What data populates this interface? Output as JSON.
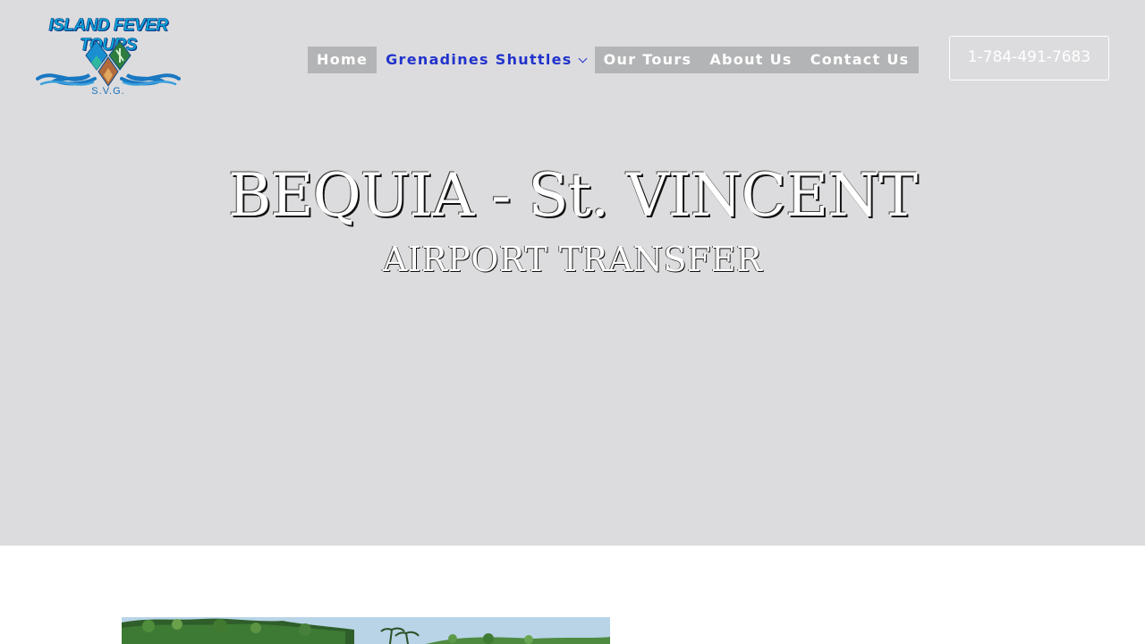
{
  "logo": {
    "title": "ISLAND FEVER TOURS",
    "subtitle": "S.V.G."
  },
  "nav": {
    "items": [
      {
        "label": "Home",
        "active": false
      },
      {
        "label": "Grenadines Shuttles",
        "active": true,
        "has_dropdown": true
      },
      {
        "label": "Our Tours",
        "active": false
      },
      {
        "label": "About Us",
        "active": false
      },
      {
        "label": "Contact Us",
        "active": false
      }
    ]
  },
  "header": {
    "phone": "1-784-491-7683"
  },
  "hero": {
    "title": "BEQUIA - St. VINCENT",
    "subtitle": "AIRPORT TRANSFER"
  },
  "colors": {
    "hero_background": "#dcdcde",
    "nav_background": "#b3b4b6",
    "nav_active_text": "#2233cc",
    "logo_blue": "#1670b8"
  }
}
